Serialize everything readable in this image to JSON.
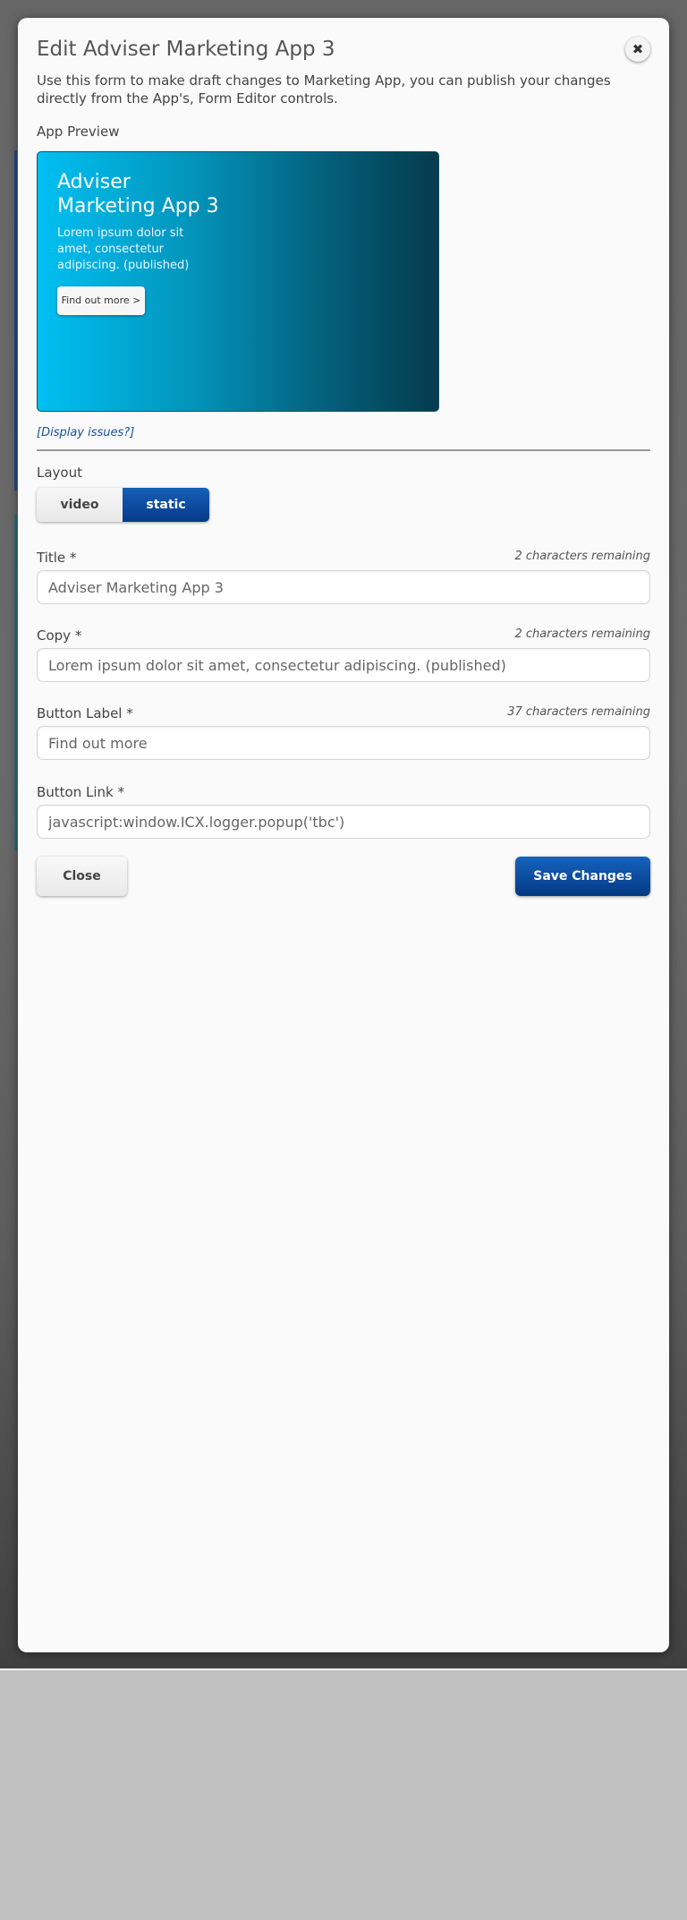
{
  "modal": {
    "title": "Edit Adviser Marketing App 3",
    "close_icon": "✖",
    "intro": "Use this form to make draft changes to Marketing App, you can publish your changes directly from the App's, Form Editor controls."
  },
  "preview": {
    "section_label": "App Preview",
    "title": "Adviser Marketing App 3",
    "copy": "Lorem ipsum dolor sit amet, consectetur adipiscing. (published)",
    "button_label": "Find out more >",
    "display_issues_link": "[Display issues?]"
  },
  "layout": {
    "label": "Layout",
    "options": [
      "video",
      "static"
    ],
    "selected": "static"
  },
  "fields": {
    "title": {
      "label": "Title *",
      "remaining": "2 characters remaining",
      "value": "Adviser Marketing App 3"
    },
    "copy": {
      "label": "Copy *",
      "remaining": "2 characters remaining",
      "value": "Lorem ipsum dolor sit amet, consectetur adipiscing. (published)"
    },
    "button_label": {
      "label": "Button Label *",
      "remaining": "37 characters remaining",
      "value": "Find out more"
    },
    "button_link": {
      "label": "Button Link *",
      "value": "javascript:window.ICX.logger.popup('tbc')"
    }
  },
  "actions": {
    "close_label": "Close",
    "save_label": "Save Changes"
  },
  "colors": {
    "primary_button": "#0a4a9c",
    "preview_gradient_start": "#00c0f2",
    "preview_gradient_end": "#053b4d",
    "link": "#1a4f9c"
  },
  "icons": {
    "close": "close-icon"
  }
}
